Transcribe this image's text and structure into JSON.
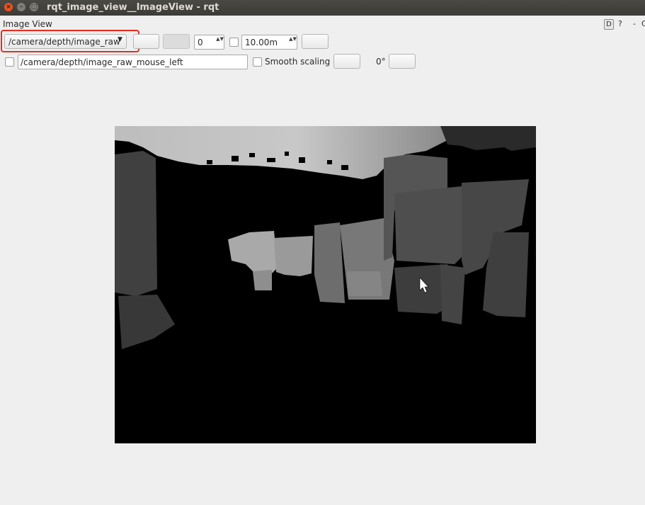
{
  "window": {
    "title": "rqt_image_view__ImageView - rqt",
    "close_glyph": "×",
    "min_glyph": "–",
    "max_glyph": "□"
  },
  "plugin": {
    "title": "Image View",
    "dock_d": "D",
    "dock_help": "?",
    "dock_dash": "-",
    "dock_close": "C"
  },
  "toolbar": {
    "topic": "/camera/depth/image_raw",
    "topic_arrow": "▼",
    "min_value": "0",
    "max_value": "10.00m",
    "spin_arrows": "▲▼"
  },
  "toolbar2": {
    "mouse_topic": "/camera/depth/image_raw_mouse_left",
    "smooth_label": "Smooth scaling",
    "rotation": "0°"
  },
  "colors": {
    "highlight": "#ea2b1f",
    "image_bg": "#000000"
  },
  "image": {
    "description_icon": "depth-image",
    "cursor_icon": "mouse-pointer-icon"
  }
}
